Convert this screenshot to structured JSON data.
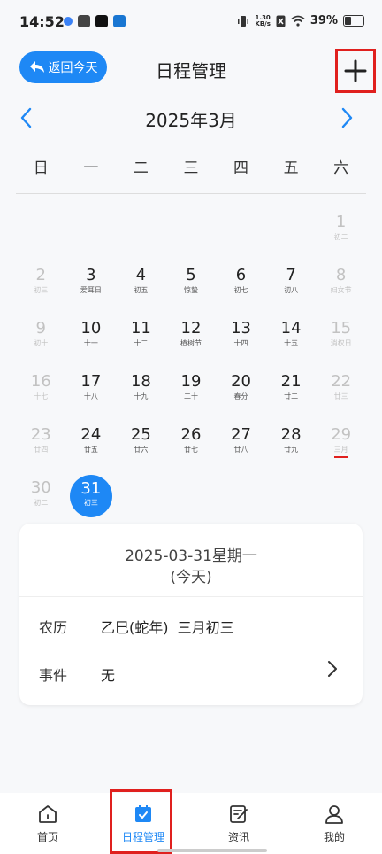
{
  "status_bar": {
    "time": "14:52",
    "speed_value": "1.30",
    "speed_unit": "KB/s",
    "battery": "39%",
    "battery_level": 0.39
  },
  "header": {
    "back_today_label": "返回今天",
    "title": "日程管理",
    "add_icon": "plus-icon"
  },
  "calendar": {
    "month_label": "2025年3月",
    "weekdays": [
      "日",
      "一",
      "二",
      "三",
      "四",
      "五",
      "六"
    ],
    "rows": [
      [
        null,
        null,
        null,
        null,
        null,
        null,
        {
          "day": "1",
          "sub": "初二",
          "muted": true
        }
      ],
      [
        {
          "day": "2",
          "sub": "初三",
          "muted": true
        },
        {
          "day": "3",
          "sub": "爱耳日"
        },
        {
          "day": "4",
          "sub": "初五"
        },
        {
          "day": "5",
          "sub": "惊蛰"
        },
        {
          "day": "6",
          "sub": "初七"
        },
        {
          "day": "7",
          "sub": "初八"
        },
        {
          "day": "8",
          "sub": "妇女节",
          "muted": true
        }
      ],
      [
        {
          "day": "9",
          "sub": "初十",
          "muted": true
        },
        {
          "day": "10",
          "sub": "十一"
        },
        {
          "day": "11",
          "sub": "十二"
        },
        {
          "day": "12",
          "sub": "植树节"
        },
        {
          "day": "13",
          "sub": "十四"
        },
        {
          "day": "14",
          "sub": "十五"
        },
        {
          "day": "15",
          "sub": "消权日",
          "muted": true
        }
      ],
      [
        {
          "day": "16",
          "sub": "十七",
          "muted": true
        },
        {
          "day": "17",
          "sub": "十八"
        },
        {
          "day": "18",
          "sub": "十九"
        },
        {
          "day": "19",
          "sub": "二十"
        },
        {
          "day": "20",
          "sub": "春分"
        },
        {
          "day": "21",
          "sub": "廿二"
        },
        {
          "day": "22",
          "sub": "廿三",
          "muted": true
        }
      ],
      [
        {
          "day": "23",
          "sub": "廿四",
          "muted": true
        },
        {
          "day": "24",
          "sub": "廿五"
        },
        {
          "day": "25",
          "sub": "廿六"
        },
        {
          "day": "26",
          "sub": "廿七"
        },
        {
          "day": "27",
          "sub": "廿八"
        },
        {
          "day": "28",
          "sub": "廿九"
        },
        {
          "day": "29",
          "sub": "三月",
          "muted": true,
          "underline": true
        }
      ],
      [
        {
          "day": "30",
          "sub": "初二",
          "muted": true
        },
        {
          "day": "31",
          "sub": "初三",
          "today": true
        },
        null,
        null,
        null,
        null,
        null
      ]
    ]
  },
  "detail": {
    "date": "2025-03-31星期一",
    "today_label": "(今天)",
    "lunar_label": "农历",
    "lunar_value": "乙巳(蛇年)  三月初三",
    "event_label": "事件",
    "event_value": "无"
  },
  "bottom_nav": [
    {
      "label": "首页",
      "icon": "home-icon"
    },
    {
      "label": "日程管理",
      "icon": "calendar-check-icon",
      "active": true
    },
    {
      "label": "资讯",
      "icon": "news-icon"
    },
    {
      "label": "我的",
      "icon": "user-icon"
    }
  ],
  "colors": {
    "accent": "#1e88f5",
    "highlight_box": "#e0201e",
    "muted": "#c2c2c2"
  }
}
